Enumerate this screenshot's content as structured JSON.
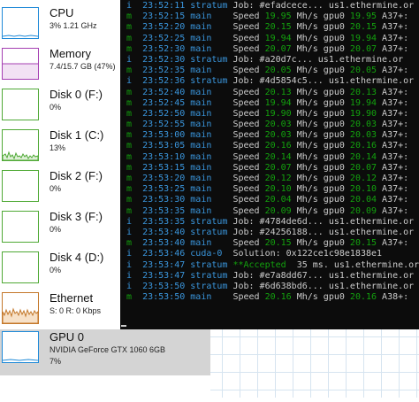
{
  "task_manager": {
    "items": [
      {
        "name": "CPU",
        "sub": "3%  1.21 GHz",
        "color": "#1f8ad8",
        "selected": false,
        "graph": "cpu"
      },
      {
        "name": "Memory",
        "sub": "7.4/15.7 GB (47%)",
        "color": "#a43fb2",
        "selected": false,
        "graph": "memory"
      },
      {
        "name": "Disk 0 (F:)",
        "sub": "0%",
        "color": "#4fa935",
        "selected": false,
        "graph": "disk"
      },
      {
        "name": "Disk 1 (C:)",
        "sub": "13%",
        "color": "#4fa935",
        "selected": false,
        "graph": "disk1"
      },
      {
        "name": "Disk 2 (F:)",
        "sub": "0%",
        "color": "#4fa935",
        "selected": false,
        "graph": "disk"
      },
      {
        "name": "Disk 3 (F:)",
        "sub": "0%",
        "color": "#4fa935",
        "selected": false,
        "graph": "disk"
      },
      {
        "name": "Disk 4 (D:)",
        "sub": "0%",
        "color": "#4fa935",
        "selected": false,
        "graph": "disk"
      },
      {
        "name": "Ethernet",
        "sub": "S: 0  R: 0 Kbps",
        "color": "#c4782a",
        "selected": false,
        "graph": "ethernet"
      },
      {
        "name": "GPU 0",
        "sub": "NVIDIA GeForce GTX 1060 6GB",
        "sub2": "7%",
        "color": "#1f8ad8",
        "selected": true,
        "graph": "gpu"
      }
    ]
  },
  "console": {
    "lines": [
      {
        "lvl": "i",
        "ts": "23:52:11",
        "src": "stratum",
        "msg": "Job: #efadcece... us1.ethermine.or"
      },
      {
        "lvl": "m",
        "ts": "23:52:15",
        "src": "main",
        "msg": "Speed ",
        "rate": "19.95",
        "unit": " Mh/s gpu0 ",
        "rate2": "19.95",
        "tail": " A37+:"
      },
      {
        "lvl": "m",
        "ts": "23:52:20",
        "src": "main",
        "msg": "Speed ",
        "rate": "20.15",
        "unit": " Mh/s gpu0 ",
        "rate2": "20.15",
        "tail": " A37+:"
      },
      {
        "lvl": "m",
        "ts": "23:52:25",
        "src": "main",
        "msg": "Speed ",
        "rate": "19.94",
        "unit": " Mh/s gpu0 ",
        "rate2": "19.94",
        "tail": " A37+:"
      },
      {
        "lvl": "m",
        "ts": "23:52:30",
        "src": "main",
        "msg": "Speed ",
        "rate": "20.07",
        "unit": " Mh/s gpu0 ",
        "rate2": "20.07",
        "tail": " A37+:"
      },
      {
        "lvl": "i",
        "ts": "23:52:30",
        "src": "stratum",
        "msg": "Job: #a20d7c... us1.ethermine.or"
      },
      {
        "lvl": "m",
        "ts": "23:52:35",
        "src": "main",
        "msg": "Speed ",
        "rate": "20.05",
        "unit": " Mh/s gpu0 ",
        "rate2": "20.05",
        "tail": " A37+:"
      },
      {
        "lvl": "i",
        "ts": "23:52:36",
        "src": "stratum",
        "msg": "Job: #4d5854c5... us1.ethermine.or"
      },
      {
        "lvl": "m",
        "ts": "23:52:40",
        "src": "main",
        "msg": "Speed ",
        "rate": "20.13",
        "unit": " Mh/s gpu0 ",
        "rate2": "20.13",
        "tail": " A37+:"
      },
      {
        "lvl": "m",
        "ts": "23:52:45",
        "src": "main",
        "msg": "Speed ",
        "rate": "19.94",
        "unit": " Mh/s gpu0 ",
        "rate2": "19.94",
        "tail": " A37+:"
      },
      {
        "lvl": "m",
        "ts": "23:52:50",
        "src": "main",
        "msg": "Speed ",
        "rate": "19.90",
        "unit": " Mh/s gpu0 ",
        "rate2": "19.90",
        "tail": " A37+:"
      },
      {
        "lvl": "m",
        "ts": "23:52:55",
        "src": "main",
        "msg": "Speed ",
        "rate": "20.03",
        "unit": " Mh/s gpu0 ",
        "rate2": "20.03",
        "tail": " A37+:"
      },
      {
        "lvl": "m",
        "ts": "23:53:00",
        "src": "main",
        "msg": "Speed ",
        "rate": "20.03",
        "unit": " Mh/s gpu0 ",
        "rate2": "20.03",
        "tail": " A37+:"
      },
      {
        "lvl": "m",
        "ts": "23:53:05",
        "src": "main",
        "msg": "Speed ",
        "rate": "20.16",
        "unit": " Mh/s gpu0 ",
        "rate2": "20.16",
        "tail": " A37+:"
      },
      {
        "lvl": "m",
        "ts": "23:53:10",
        "src": "main",
        "msg": "Speed ",
        "rate": "20.14",
        "unit": " Mh/s gpu0 ",
        "rate2": "20.14",
        "tail": " A37+:"
      },
      {
        "lvl": "m",
        "ts": "23:53:15",
        "src": "main",
        "msg": "Speed ",
        "rate": "20.07",
        "unit": " Mh/s gpu0 ",
        "rate2": "20.07",
        "tail": " A37+:"
      },
      {
        "lvl": "m",
        "ts": "23:53:20",
        "src": "main",
        "msg": "Speed ",
        "rate": "20.12",
        "unit": " Mh/s gpu0 ",
        "rate2": "20.12",
        "tail": " A37+:"
      },
      {
        "lvl": "m",
        "ts": "23:53:25",
        "src": "main",
        "msg": "Speed ",
        "rate": "20.10",
        "unit": " Mh/s gpu0 ",
        "rate2": "20.10",
        "tail": " A37+:"
      },
      {
        "lvl": "m",
        "ts": "23:53:30",
        "src": "main",
        "msg": "Speed ",
        "rate": "20.04",
        "unit": " Mh/s gpu0 ",
        "rate2": "20.04",
        "tail": " A37+:"
      },
      {
        "lvl": "m",
        "ts": "23:53:35",
        "src": "main",
        "msg": "Speed ",
        "rate": "20.09",
        "unit": " Mh/s gpu0 ",
        "rate2": "20.09",
        "tail": " A37+:"
      },
      {
        "lvl": "i",
        "ts": "23:53:35",
        "src": "stratum",
        "msg": "Job: #4784de6d... us1.ethermine.or"
      },
      {
        "lvl": "i",
        "ts": "23:53:40",
        "src": "stratum",
        "msg": "Job: #24256188... us1.ethermine.or"
      },
      {
        "lvl": "m",
        "ts": "23:53:40",
        "src": "main",
        "msg": "Speed ",
        "rate": "20.15",
        "unit": " Mh/s gpu0 ",
        "rate2": "20.15",
        "tail": " A37+:"
      },
      {
        "lvl": "i",
        "ts": "23:53:46",
        "src": "cuda-0",
        "msg": "Solution: 0x122ce1c98e1838e1"
      },
      {
        "lvl": "i",
        "ts": "23:53:47",
        "src": "stratum",
        "acc": "**Accepted",
        "msg": "  35 ms. us1.ethermine.or"
      },
      {
        "lvl": "i",
        "ts": "23:53:47",
        "src": "stratum",
        "msg": "Job: #e7a8dd67... us1.ethermine.or"
      },
      {
        "lvl": "i",
        "ts": "23:53:50",
        "src": "stratum",
        "msg": "Job: #6d638bd6... us1.ethermine.or"
      },
      {
        "lvl": "m",
        "ts": "23:53:50",
        "src": "main",
        "msg": "Speed ",
        "rate": "20.16",
        "unit": " Mh/s gpu0 ",
        "rate2": "20.16",
        "tail": " A38+:"
      }
    ]
  }
}
